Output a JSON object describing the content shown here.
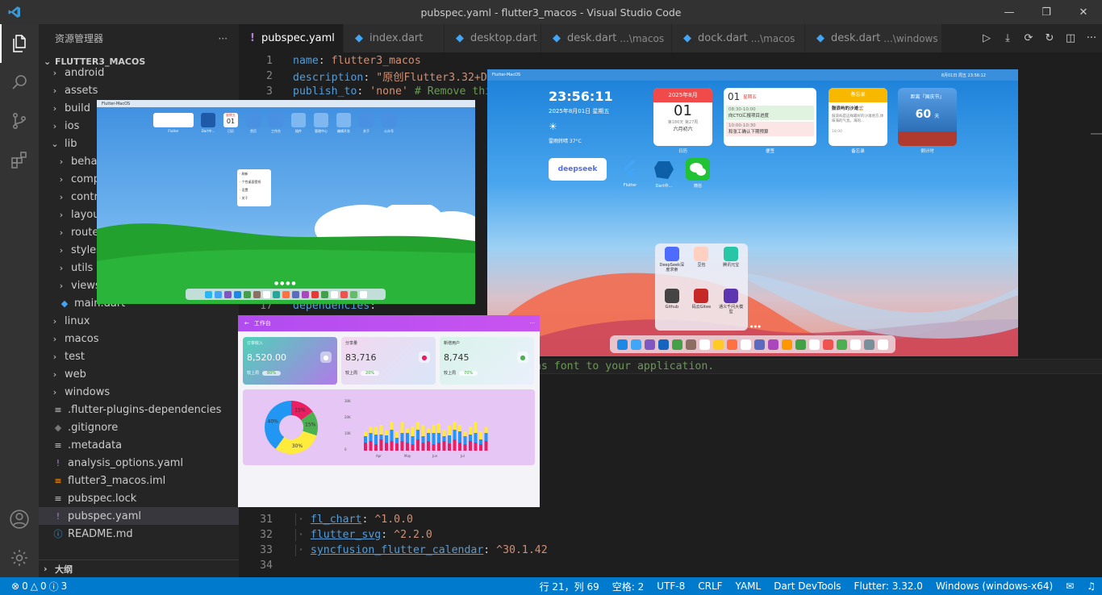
{
  "titlebar": {
    "title": "pubspec.yaml - flutter3_macos - Visual Studio Code"
  },
  "sidebar": {
    "header": "资源管理器",
    "more": "···",
    "root": "FLUTTER3_MACOS",
    "items": [
      {
        "label": "android",
        "type": "folder",
        "depth": 1
      },
      {
        "label": "assets",
        "type": "folder",
        "depth": 1
      },
      {
        "label": "build",
        "type": "folder",
        "depth": 1
      },
      {
        "label": "ios",
        "type": "folder",
        "depth": 1
      },
      {
        "label": "lib",
        "type": "folder-open",
        "depth": 1
      },
      {
        "label": "behav",
        "type": "folder",
        "depth": 2
      },
      {
        "label": "comp",
        "type": "folder",
        "depth": 2
      },
      {
        "label": "contr",
        "type": "folder",
        "depth": 2
      },
      {
        "label": "layou",
        "type": "folder",
        "depth": 2
      },
      {
        "label": "route",
        "type": "folder",
        "depth": 2
      },
      {
        "label": "styles",
        "type": "folder",
        "depth": 2
      },
      {
        "label": "utils",
        "type": "folder",
        "depth": 2
      },
      {
        "label": "views",
        "type": "folder",
        "depth": 2
      },
      {
        "label": "main.dart",
        "type": "dart",
        "depth": 2
      },
      {
        "label": "linux",
        "type": "folder",
        "depth": 1
      },
      {
        "label": "macos",
        "type": "folder",
        "depth": 1
      },
      {
        "label": "test",
        "type": "folder",
        "depth": 1
      },
      {
        "label": "web",
        "type": "folder",
        "depth": 1
      },
      {
        "label": "windows",
        "type": "folder",
        "depth": 1
      },
      {
        "label": ".flutter-plugins-dependencies",
        "type": "file",
        "depth": 1
      },
      {
        "label": ".gitignore",
        "type": "git",
        "depth": 1
      },
      {
        "label": ".metadata",
        "type": "file",
        "depth": 1
      },
      {
        "label": "analysis_options.yaml",
        "type": "yaml",
        "depth": 1
      },
      {
        "label": "flutter3_macos.iml",
        "type": "iml",
        "depth": 1
      },
      {
        "label": "pubspec.lock",
        "type": "file",
        "depth": 1
      },
      {
        "label": "pubspec.yaml",
        "type": "yaml",
        "depth": 1,
        "selected": true
      },
      {
        "label": "README.md",
        "type": "info",
        "depth": 1
      }
    ],
    "outline": "大纲"
  },
  "tabs": [
    {
      "label": "pubspec.yaml",
      "icon": "!",
      "active": true,
      "close": "×"
    },
    {
      "label": "index.dart",
      "icon": "dart"
    },
    {
      "label": "desktop.dart",
      "icon": "dart"
    },
    {
      "label": "desk.dart",
      "hint": "...\\macos",
      "icon": "dart"
    },
    {
      "label": "dock.dart",
      "hint": "...\\macos",
      "icon": "dart"
    },
    {
      "label": "desk.dart",
      "hint": "...\\windows",
      "icon": "dart"
    }
  ],
  "editor": {
    "lines": [
      {
        "n": "1",
        "y": 0,
        "html": "<span class='k'>name</span>: <span class='s'>flutter3_macos</span>"
      },
      {
        "n": "2",
        "y": 19,
        "html": "<span class='k'>description</span>: <span class='s'>\"原创Flutter3.32+Da</span>"
      },
      {
        "n": "3",
        "y": 38,
        "html": "<span class='k'>publish_to</span>: <span class='s'>'none'</span> <span class='c'># Remove this</span>"
      },
      {
        "n": "17",
        "y": 304,
        "html": "<span class='k'>dependencies</span>:"
      }
    ],
    "line_numbers_visible": [
      "1",
      "2",
      "3",
      "17"
    ],
    "comment": "ons font to your application.",
    "tail": [
      {
        "n": "31",
        "name": "fl_chart",
        "ver": "^1.0.0"
      },
      {
        "n": "32",
        "name": "flutter_svg",
        "ver": "^2.2.0"
      },
      {
        "n": "33",
        "name": "syncfusion_flutter_calendar",
        "ver": "^30.1.42"
      },
      {
        "n": "34",
        "name": "",
        "ver": ""
      }
    ]
  },
  "status": {
    "errors": "0",
    "warnings": "0",
    "info": "3",
    "position": "行 21，列 69",
    "spaces": "空格: 2",
    "encoding": "UTF-8",
    "eol": "CRLF",
    "lang": "YAML",
    "devtools": "Dart DevTools",
    "flutter": "Flutter: 3.32.0",
    "platform": "Windows (windows-x64)"
  },
  "overlay_win": {
    "title": "Flutter-MacOS",
    "dock_apps": [
      "Flutter",
      "Dart中...",
      "日历",
      "首页",
      "工作台",
      "插件",
      "管理中心",
      "编辑开发",
      "关于",
      "公众号"
    ],
    "cal_day": "01",
    "cal_month": "星期五",
    "menu": [
      "刷新",
      "个性桌面壁纸",
      "设置",
      "关于"
    ]
  },
  "overlay_mac": {
    "title": "Flutter-MacOS",
    "time": "23:56:11",
    "date": "2025年8月01日 星期五",
    "weather": "雷雨转晴 37°C",
    "cal_header": "2025年8月",
    "cal_day": "01",
    "cal_sub1": "第186天 第27周",
    "cal_sub2": "六月初六",
    "cal_label": "日历",
    "note_day": "01",
    "note_weekday": "星期五",
    "note1_time": "08:30-10:00",
    "note1_text": "向CTO汇报项目进度",
    "note2_time": "10:00-10:30",
    "note2_text": "和张工确认下期预算",
    "note_label": "便签",
    "memo_header": "备忘录",
    "memo_title": "鼓浪屿的沙滩🏖️",
    "memo_text": "鼓浪屿是这样最好的沙滩地方,体味海的气息。海的...",
    "memo_time": "18:00",
    "memo_label": "备忘录",
    "count_header": "距离『国庆节』",
    "count_days": "60",
    "count_unit": "天",
    "count_label": "倒计时",
    "icon_labels": [
      "Flutter",
      "Dart中...",
      "微信"
    ],
    "brand": "deepseek",
    "topbar_right": "8月01日 周五  23:56:12",
    "launcher": [
      "DeepSeek深度求索",
      "豆包",
      "腾讯元宝",
      "Github",
      "码云Gitee",
      "通义千问大模型"
    ]
  },
  "overlay_work": {
    "title": "工作台",
    "cards": [
      {
        "label": "订单收入",
        "value": "8,520.00",
        "foot": "较上周",
        "badge": "80%"
      },
      {
        "label": "分享量",
        "value": "83,716",
        "foot": "较上周",
        "badge": "20%"
      },
      {
        "label": "新增用户",
        "value": "8,745",
        "foot": "较上周",
        "badge": "70%"
      }
    ],
    "chart_data": [
      {
        "type": "pie",
        "values": [
          15,
          15,
          30,
          40
        ],
        "labels": [
          "15%",
          "15%",
          "30%",
          "40%"
        ],
        "colors": [
          "#e91e63",
          "#4caf50",
          "#ffeb3b",
          "#2196f3"
        ]
      },
      {
        "type": "bar",
        "categories": [
          "Apr",
          "May",
          "Jun",
          "Jul"
        ],
        "yticks": [
          "30K",
          "20K",
          "10K",
          "0"
        ]
      }
    ]
  }
}
